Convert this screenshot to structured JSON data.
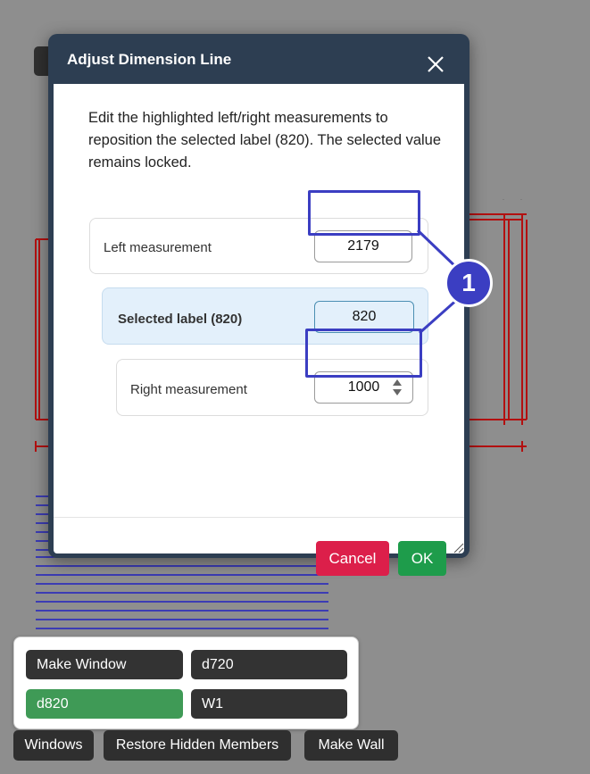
{
  "modal": {
    "title": "Adjust Dimension Line",
    "instructions": "Edit the highlighted left/right measurements to reposition the selected label (820). The selected value remains locked.",
    "left_label": "Left measurement",
    "left_value": "2179",
    "selected_label": "Selected label (820)",
    "selected_value": "820",
    "right_label": "Right measurement",
    "right_value": "1000",
    "cancel_label": "Cancel",
    "ok_label": "OK"
  },
  "callout": {
    "number": "1"
  },
  "bottom_panel": {
    "make_window": "Make Window",
    "d720": "d720",
    "d820": "d820",
    "w1": "W1"
  },
  "toolbar": {
    "windows": "Windows",
    "restore_hidden": "Restore Hidden Members",
    "make_wall": "Make Wall"
  },
  "colors": {
    "accent": "#3b3ec2",
    "cancel": "#dc1f4a",
    "ok": "#1e9c4b",
    "header": "#2d3e52",
    "selected_chip": "#3f9a56"
  }
}
